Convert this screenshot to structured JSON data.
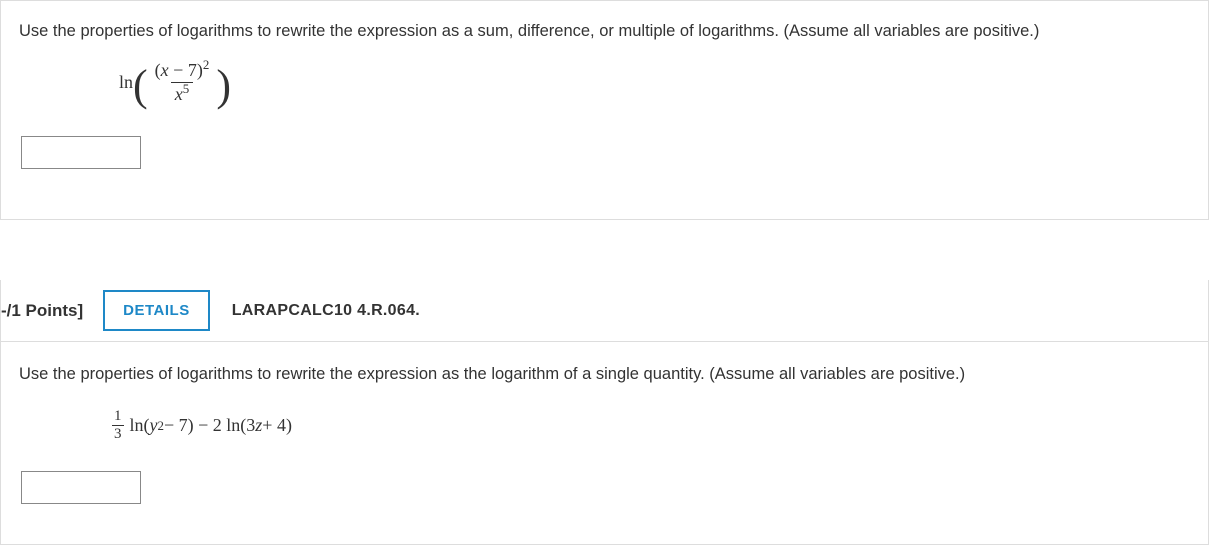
{
  "q1": {
    "prompt": "Use the properties of logarithms to rewrite the expression as a sum, difference, or multiple of logarithms. (Assume all variables are positive.)",
    "math": {
      "ln": "ln",
      "num_part1": "(",
      "num_var": "x",
      "num_minus": " − 7)",
      "num_exp": "2",
      "den_var": "x",
      "den_exp": "5"
    },
    "answer": ""
  },
  "header2": {
    "points": "-/1 Points]",
    "details": "DETAILS",
    "ref": "LARAPCALC10 4.R.064."
  },
  "q2": {
    "prompt": "Use the properties of logarithms to rewrite the expression as the logarithm of a single quantity. (Assume all variables are positive.)",
    "math": {
      "frac_num": "1",
      "frac_den": "3",
      "part_a_pre": " ln(",
      "part_a_var": "y",
      "part_a_exp": "2",
      "part_a_post": " − 7) − 2 ln(3",
      "part_b_var": "z",
      "part_b_post": " + 4)"
    },
    "answer": ""
  }
}
